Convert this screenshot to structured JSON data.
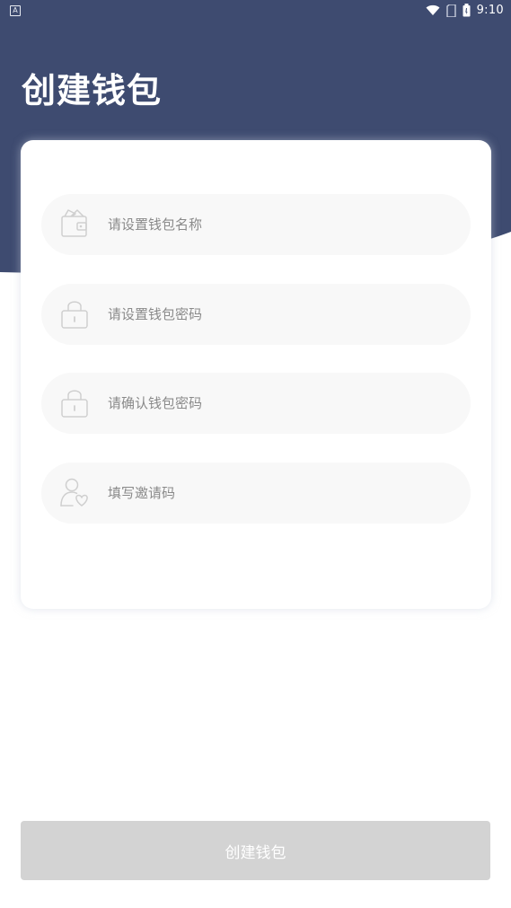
{
  "status_bar": {
    "time": "9:10",
    "left_icon": "notification-a-icon",
    "icons": [
      "wifi-icon",
      "sim-icon",
      "battery-icon"
    ]
  },
  "page": {
    "title": "创建钱包"
  },
  "form": {
    "fields": [
      {
        "name": "wallet-name",
        "icon": "wallet-icon",
        "placeholder": "请设置钱包名称",
        "value": ""
      },
      {
        "name": "wallet-password",
        "icon": "lock-icon",
        "placeholder": "请设置钱包密码",
        "value": ""
      },
      {
        "name": "confirm-password",
        "icon": "lock-icon",
        "placeholder": "请确认钱包密码",
        "value": ""
      },
      {
        "name": "invite-code",
        "icon": "user-heart-icon",
        "placeholder": "填写邀请码",
        "value": ""
      }
    ]
  },
  "actions": {
    "submit_label": "创建钱包"
  },
  "colors": {
    "header_bg": "#3e4b70",
    "card_bg": "#ffffff",
    "field_bg": "#f8f8f8",
    "placeholder": "#8a8a8a",
    "button_disabled": "#d3d3d3",
    "button_text": "#ffffff"
  }
}
